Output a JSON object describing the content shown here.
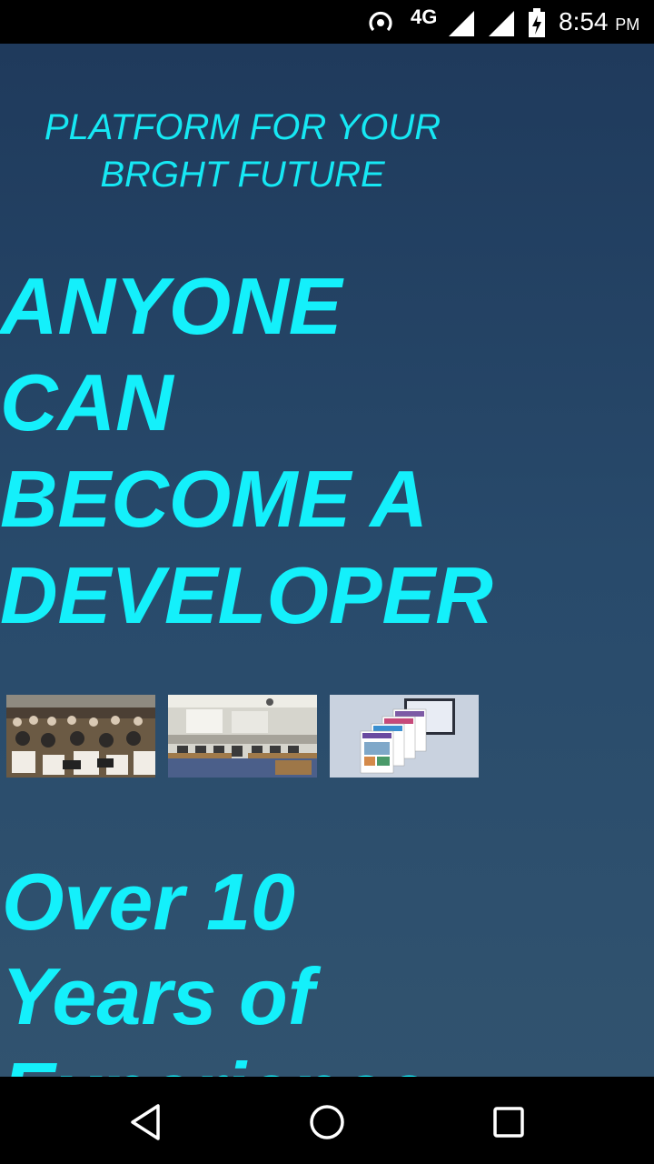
{
  "status_bar": {
    "network_label": "4G",
    "time": "8:54",
    "ampm": "PM",
    "icons": [
      "hotspot-icon",
      "signal-icon",
      "signal-icon",
      "battery-charging-icon"
    ]
  },
  "hero": {
    "tagline_line1": "PLATFORM FOR YOUR",
    "tagline_line2": "BRGHT FUTURE",
    "headline_lines": [
      "ANYONE",
      "CAN",
      "BECOME A",
      "DEVELOPER"
    ]
  },
  "gallery": {
    "images": [
      "lecture-hall-photo",
      "computer-lab-photo",
      "website-screens-photo"
    ]
  },
  "experience": {
    "lines": [
      "Over 10",
      "Years of",
      "Experience"
    ]
  },
  "nav_bar": {
    "buttons": [
      "back-icon",
      "home-icon",
      "recents-icon"
    ]
  },
  "colors": {
    "accent": "#14f0fb",
    "background_top": "#1f3a5c",
    "background_bottom": "#31536f"
  }
}
